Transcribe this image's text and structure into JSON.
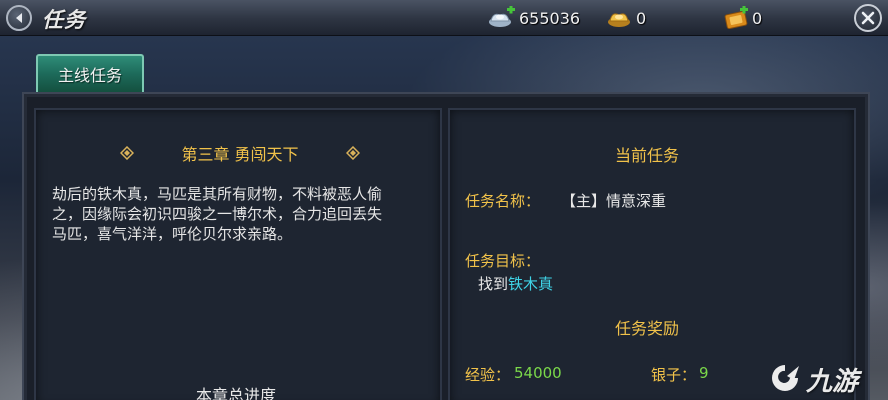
{
  "header": {
    "title": "任务",
    "currencies": [
      {
        "icon": "silver-ingot-icon",
        "value": "655036"
      },
      {
        "icon": "gold-ingot-icon",
        "value": "0"
      },
      {
        "icon": "ticket-icon",
        "value": "0"
      }
    ]
  },
  "tabs": [
    {
      "label": "主线任务",
      "active": true
    }
  ],
  "left_panel": {
    "chapter_title": "第三章 勇闯天下",
    "story_lines": [
      "劫后的铁木真，马匹是其所有财物，不料被恶人偷",
      "之，因缘际会初识四骏之一博尔术，合力追回丢失",
      "马匹，喜气洋洋，呼伦贝尔求亲路。"
    ],
    "progress_label": "本章总进度"
  },
  "right_panel": {
    "current_heading": "当前任务",
    "name_label": "任务名称：",
    "name_value": "【主】情意深重",
    "goal_label": "任务目标：",
    "goal_prefix": "找到",
    "goal_target": "铁木真",
    "reward_heading": "任务奖励",
    "exp_label": "经验：",
    "exp_value": "54000",
    "silver_label": "银子：",
    "silver_value": "9"
  },
  "watermark": {
    "text": "九游"
  },
  "colors": {
    "gold_text": "#f1c24a",
    "cyan_target": "#3fd3e6",
    "green_value": "#7bd94a",
    "tab_green": "#1d6a5a"
  }
}
